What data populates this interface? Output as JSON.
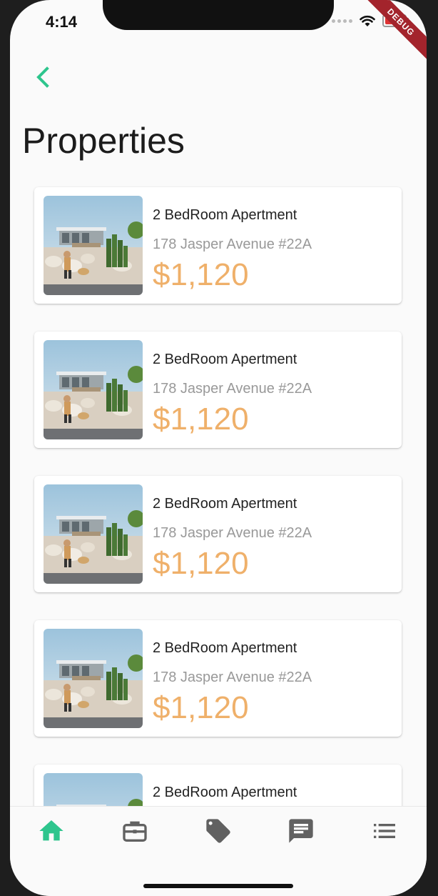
{
  "status_bar": {
    "time": "4:14",
    "debug_label": "DEBUG"
  },
  "page": {
    "title": "Properties"
  },
  "properties": [
    {
      "title": "2 BedRoom Apertment",
      "address": "178 Jasper Avenue #22A",
      "price": "$1,120"
    },
    {
      "title": "2 BedRoom Apertment",
      "address": "178 Jasper Avenue #22A",
      "price": "$1,120"
    },
    {
      "title": "2 BedRoom Apertment",
      "address": "178 Jasper Avenue #22A",
      "price": "$1,120"
    },
    {
      "title": "2 BedRoom Apertment",
      "address": "178 Jasper Avenue #22A",
      "price": "$1,120"
    },
    {
      "title": "2 BedRoom Apertment",
      "address": "",
      "price": ""
    }
  ],
  "bottom_nav": [
    {
      "icon": "home-icon",
      "active": true
    },
    {
      "icon": "briefcase-icon",
      "active": false
    },
    {
      "icon": "tag-icon",
      "active": false
    },
    {
      "icon": "message-icon",
      "active": false
    },
    {
      "icon": "list-icon",
      "active": false
    }
  ],
  "colors": {
    "accent": "#2ec58d",
    "price": "#efb06a",
    "icon_inactive": "#616161"
  }
}
